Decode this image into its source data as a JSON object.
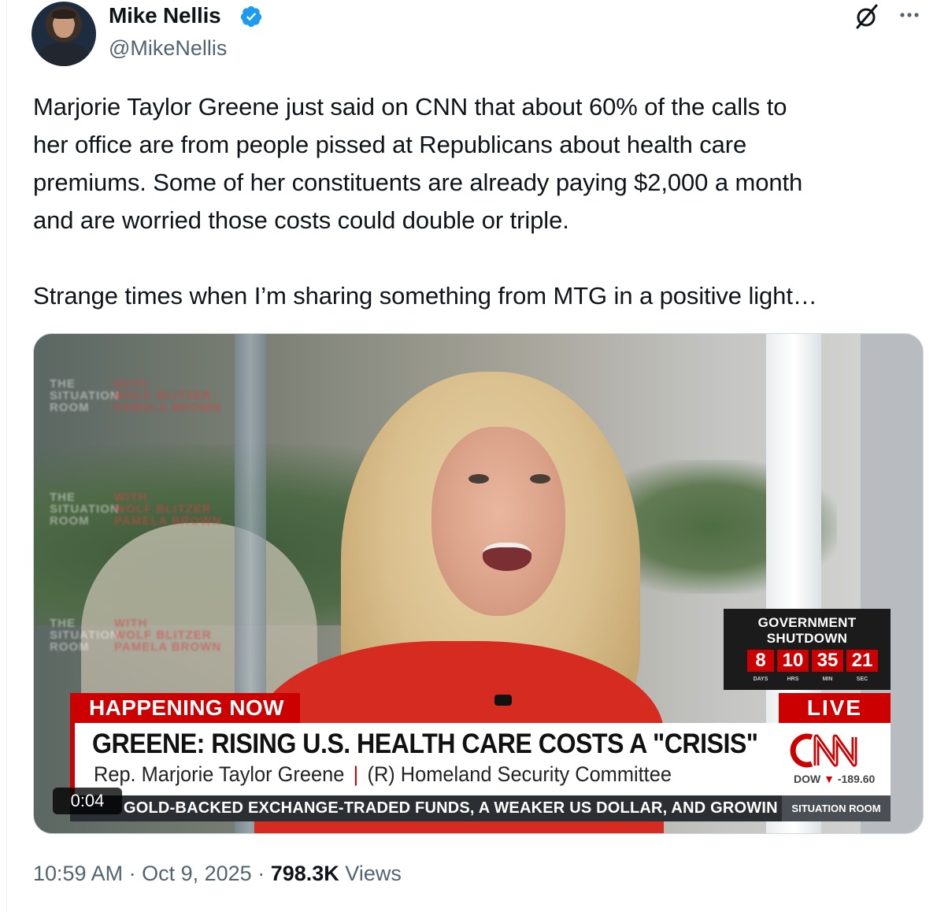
{
  "author": {
    "display_name": "Mike Nellis",
    "handle": "@MikeNellis",
    "verified_color": "#1d9bf0"
  },
  "header_icons": [
    "grok-icon",
    "more-icon"
  ],
  "tweet": {
    "text": "Marjorie Taylor Greene just said on CNN that about 60% of the calls to\nher office are from people pissed at Republicans about health care\npremiums. Some of her constituents are already paying $2,000 a month\nand are worried those costs could double or triple.\n\nStrange times when I’m sharing something from MTG in a positive light…"
  },
  "media": {
    "video_timestamp": "0:04",
    "broadcast": {
      "shutdown_title": "GOVERNMENT\nSHUTDOWN",
      "counter": [
        {
          "value": "8",
          "label": "DAYS"
        },
        {
          "value": "10",
          "label": "HRS"
        },
        {
          "value": "35",
          "label": "MIN"
        },
        {
          "value": "21",
          "label": "SEC"
        }
      ],
      "happening_now": "HAPPENING NOW",
      "live": "LIVE",
      "headline": "GREENE: RISING U.S. HEALTH CARE COSTS A \"CRISIS\"",
      "subhead_name": "Rep. Marjorie Taylor Greene",
      "subhead_role": "(R) Homeland Security Committee",
      "dow_label": "DOW",
      "dow_change": "-189.60",
      "ticker": "GOLD-BACKED EXCHANGE-TRADED FUNDS, A WEAKER US DOLLAR, AND GROWING IN",
      "ticker_brand": "SITUATION ROOM",
      "brand_color": "#cc0000"
    }
  },
  "meta": {
    "time": "10:59 AM",
    "date": "Oct 9, 2025",
    "views_count": "798.3K",
    "views_label": "Views"
  }
}
